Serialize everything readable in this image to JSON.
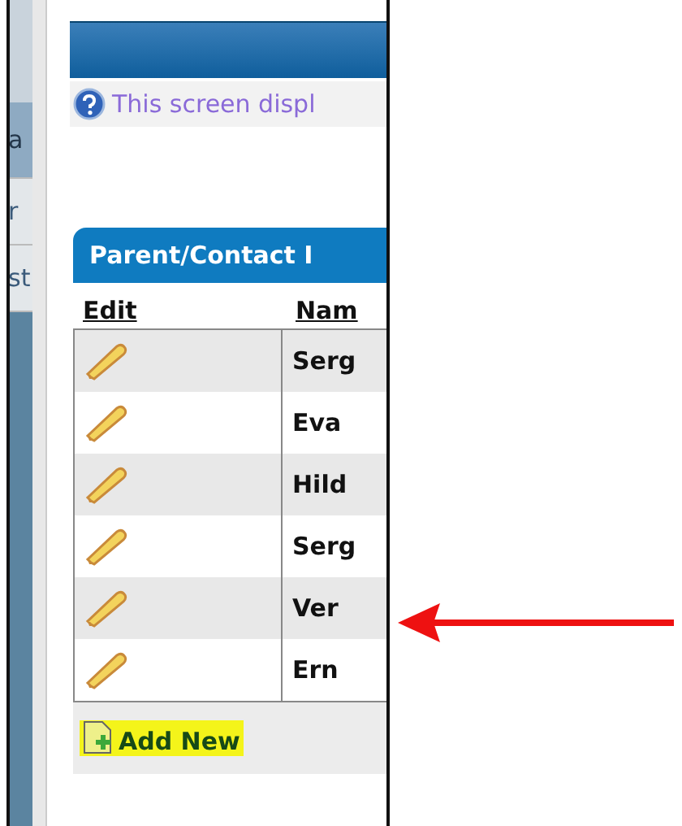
{
  "sidebar": {
    "items": [
      {
        "label": "a",
        "selected": true
      },
      {
        "label": "r",
        "selected": false
      },
      {
        "label": "st",
        "selected": false
      }
    ]
  },
  "info": {
    "text": "This screen displ"
  },
  "panel": {
    "tab": "Parent/Contact I",
    "columns": [
      "Edit",
      "Nam"
    ],
    "rows": [
      {
        "name": "Serg"
      },
      {
        "name": "Eva"
      },
      {
        "name": "Hild"
      },
      {
        "name": "Serg"
      },
      {
        "name": "Ver"
      },
      {
        "name": "Ern"
      }
    ],
    "add_button": "Add New"
  }
}
